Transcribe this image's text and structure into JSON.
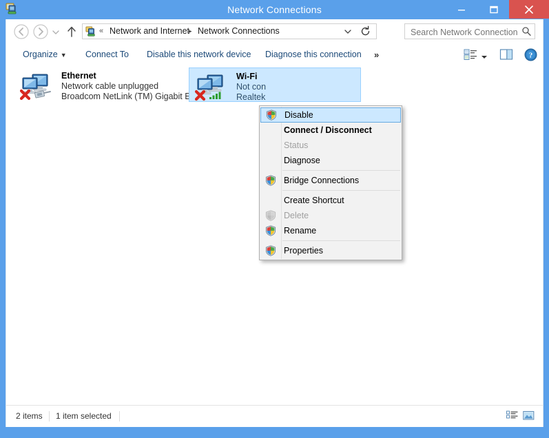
{
  "window": {
    "title": "Network Connections",
    "icon": "network-connection-icon",
    "frame_color": "#5aa0ea",
    "close_color": "#d9534f",
    "controls": {
      "minimize": "Minimize",
      "maximize": "Maximize",
      "close": "Close"
    }
  },
  "addressbar": {
    "back": "Back",
    "forward": "Forward",
    "history": "Recent locations",
    "up": "Up one level",
    "breadcrumb": {
      "icon": "network-connection-icon",
      "overflow": "«",
      "separator": "▸",
      "segments": [
        "Network and Internet",
        "Network Connections"
      ]
    },
    "dropdown": "Previous locations",
    "refresh": "Refresh",
    "search": {
      "placeholder": "Search Network Connections",
      "value": "",
      "icon": "search-icon"
    }
  },
  "toolbar": {
    "items": [
      {
        "label": "Organize",
        "has_caret": true
      },
      {
        "label": "Connect To",
        "has_caret": false
      },
      {
        "label": "Disable this network device",
        "has_caret": false
      },
      {
        "label": "Diagnose this connection",
        "has_caret": false
      }
    ],
    "overflow": "»",
    "view_icon": "change-view-icon",
    "view_caret": "chevron-down-icon",
    "pane_icon": "preview-pane-icon",
    "help_icon": "help-icon"
  },
  "connections": [
    {
      "name": "Ethernet",
      "status": "Network cable unplugged",
      "device": "Broadcom NetLink (TM) Gigabit E...",
      "selected": false,
      "badge": "red-x-icon",
      "overlay": "network-cable-icon"
    },
    {
      "name": "Wi-Fi",
      "status": "Not con",
      "device": "Realtek",
      "selected": true,
      "badge": "red-x-icon",
      "overlay": "wifi-signal-icon"
    }
  ],
  "context_menu": {
    "items": [
      {
        "label": "Disable",
        "shield": true,
        "disabled": false,
        "bold": false,
        "selected": true,
        "separator_after": false
      },
      {
        "label": "Connect / Disconnect",
        "shield": false,
        "disabled": false,
        "bold": true,
        "selected": false,
        "separator_after": false
      },
      {
        "label": "Status",
        "shield": false,
        "disabled": true,
        "bold": false,
        "selected": false,
        "separator_after": false
      },
      {
        "label": "Diagnose",
        "shield": false,
        "disabled": false,
        "bold": false,
        "selected": false,
        "separator_after": true
      },
      {
        "label": "Bridge Connections",
        "shield": true,
        "disabled": false,
        "bold": false,
        "selected": false,
        "separator_after": true
      },
      {
        "label": "Create Shortcut",
        "shield": false,
        "disabled": false,
        "bold": false,
        "selected": false,
        "separator_after": false
      },
      {
        "label": "Delete",
        "shield": true,
        "shield_disabled": true,
        "disabled": true,
        "bold": false,
        "selected": false,
        "separator_after": false
      },
      {
        "label": "Rename",
        "shield": true,
        "disabled": false,
        "bold": false,
        "selected": false,
        "separator_after": true
      },
      {
        "label": "Properties",
        "shield": true,
        "disabled": false,
        "bold": false,
        "selected": false,
        "separator_after": false
      }
    ]
  },
  "statusbar": {
    "item_count": "2 items",
    "selection": "1 item selected",
    "view_list_icon": "details-view-icon",
    "view_tiles_icon": "large-icons-view-icon"
  }
}
